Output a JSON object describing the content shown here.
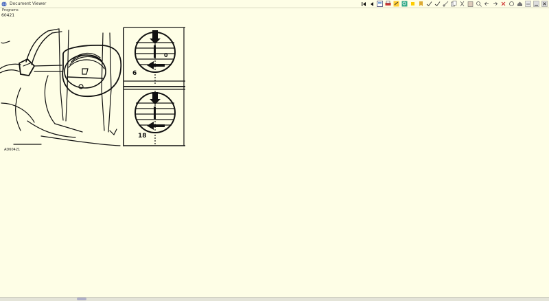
{
  "window": {
    "title": "Document Viewer",
    "app_icon": "app-globe-icon"
  },
  "menu": {
    "items": [
      "Programs"
    ]
  },
  "toolbar": {
    "icons": [
      "first-page-icon",
      "prev-page-icon",
      "page-view-icon",
      "print-icon",
      "highlight-icon",
      "zoom-icon",
      "note-icon",
      "bookmark-icon",
      "check-icon",
      "check-icon",
      "link-icon",
      "copy-icon",
      "cut-icon",
      "paste-icon",
      "find-icon",
      "back-icon",
      "forward-icon",
      "stop-icon",
      "refresh-icon",
      "home-icon",
      "help-icon",
      "minimize-icon",
      "close-icon"
    ]
  },
  "document": {
    "id": "60421",
    "figure_label": "AD60421",
    "callouts": {
      "a": "6",
      "b": "18",
      "c": "0"
    }
  },
  "colors": {
    "background": "#fefee6",
    "line": "#111111"
  }
}
